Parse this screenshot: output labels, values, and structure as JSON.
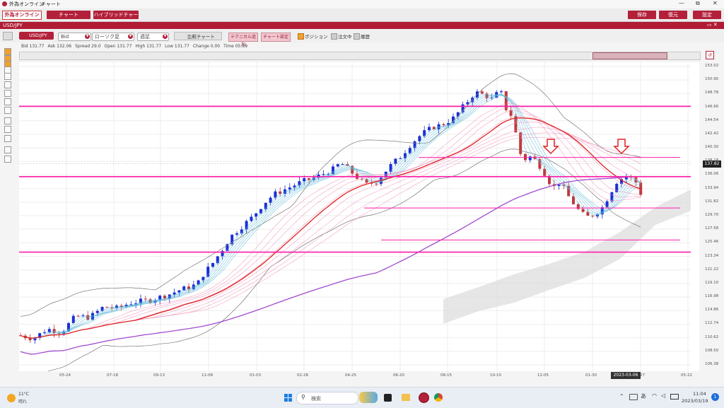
{
  "window": {
    "app_name": "外為オンライン",
    "window_title": "チャート",
    "minimize": "—",
    "maximize": "⧉",
    "close": "✕"
  },
  "header": {
    "logo": "外為オンライン",
    "tabs": [
      "チャート",
      "ハイブリッドチャート"
    ],
    "right_buttons": [
      "保存",
      "復元",
      "設定"
    ]
  },
  "symbol_bar": {
    "symbol": "USD/JPY",
    "controls": "▭ ✕"
  },
  "toolbar": {
    "pair": "USD/JPY",
    "price_type": "Bid",
    "chart_type": "ローソク足",
    "period": "週足",
    "compare": "比較チャート",
    "technical": "テクニカル追加",
    "chart_settings": "チャート設定",
    "checks": [
      {
        "label": "ポジション",
        "checked": true
      },
      {
        "label": "注文中",
        "checked": false
      },
      {
        "label": "履歴",
        "checked": false
      }
    ]
  },
  "price_info": [
    {
      "k": "Bid",
      "v": "131.77"
    },
    {
      "k": "Ask",
      "v": "132.06"
    },
    {
      "k": "Spread",
      "v": "29.0"
    },
    {
      "k": "Open",
      "v": "131.77"
    },
    {
      "k": "High",
      "v": "131.77"
    },
    {
      "k": "Low",
      "v": "131.77"
    },
    {
      "k": "Change",
      "v": "0.00"
    },
    {
      "k": "Time",
      "v": "05:59"
    }
  ],
  "y_axis": [
    "153.02",
    "150.90",
    "148.78",
    "146.66",
    "144.54",
    "142.42",
    "140.30",
    "138.18",
    "136.06",
    "133.94",
    "131.82",
    "129.70",
    "127.58",
    "125.46",
    "123.34",
    "121.22",
    "119.10",
    "116.98",
    "114.86",
    "112.74",
    "110.62",
    "108.50",
    "106.38"
  ],
  "current_price": "137.82",
  "x_axis": [
    "05-24",
    "07-18",
    "09-13",
    "11-08",
    "01-03",
    "02-28",
    "04-25",
    "06-20",
    "08-15",
    "10-10",
    "12-05",
    "01-30",
    "03-27",
    "05-22"
  ],
  "cursor_date": "2023-03-06",
  "horizontal_lines": [
    146.8,
    135.8,
    124.0,
    130.9,
    138.8,
    125.9
  ],
  "colors": {
    "brand": "#b3203a",
    "bull": "#1a2fd6",
    "bear": "#c0393d",
    "hline": "#ff1aa8",
    "ma_red": "#e01e1e",
    "ma_purple": "#a24bd0"
  },
  "taskbar": {
    "weather_temp": "11°C",
    "weather_desc": "晴れ",
    "search": "検索",
    "time": "11:04",
    "date": "2023/03/19",
    "ime": "あ",
    "notif": "1"
  },
  "icons": [
    "start-icon",
    "search-icon",
    "weather-icon",
    "edge-icon",
    "files-icon",
    "store-icon",
    "gaitame-icon",
    "chrome-icon",
    "wifi-icon",
    "volume-icon",
    "battery-icon"
  ]
}
